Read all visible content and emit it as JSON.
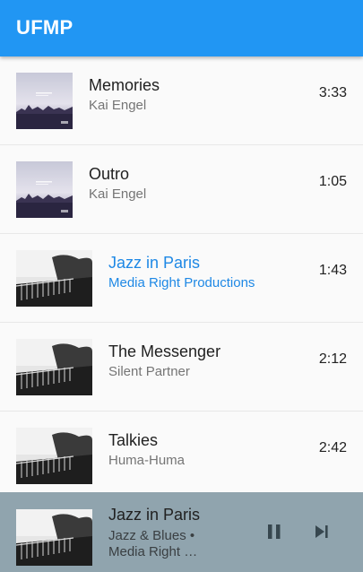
{
  "app": {
    "title": "UFMP"
  },
  "songs": [
    {
      "title": "Memories",
      "artist": "Kai Engel",
      "duration": "3:33",
      "art": "square"
    },
    {
      "title": "Outro",
      "artist": "Kai Engel",
      "duration": "1:05",
      "art": "square"
    },
    {
      "title": "Jazz in Paris",
      "artist": "Media Right Productions",
      "duration": "1:43",
      "art": "wide",
      "active": true
    },
    {
      "title": "The Messenger",
      "artist": "Silent Partner",
      "duration": "2:12",
      "art": "wide"
    },
    {
      "title": "Talkies",
      "artist": "Huma-Huma",
      "duration": "2:42",
      "art": "wide"
    }
  ],
  "player": {
    "title": "Jazz in Paris",
    "subtitle": "Jazz & Blues • Media Right …",
    "pause_icon": "pause-icon",
    "next_icon": "skip-next-icon"
  },
  "colors": {
    "appbar": "#2196f3",
    "active_text": "#1e88e5",
    "player_bg": "#90a4ae"
  }
}
